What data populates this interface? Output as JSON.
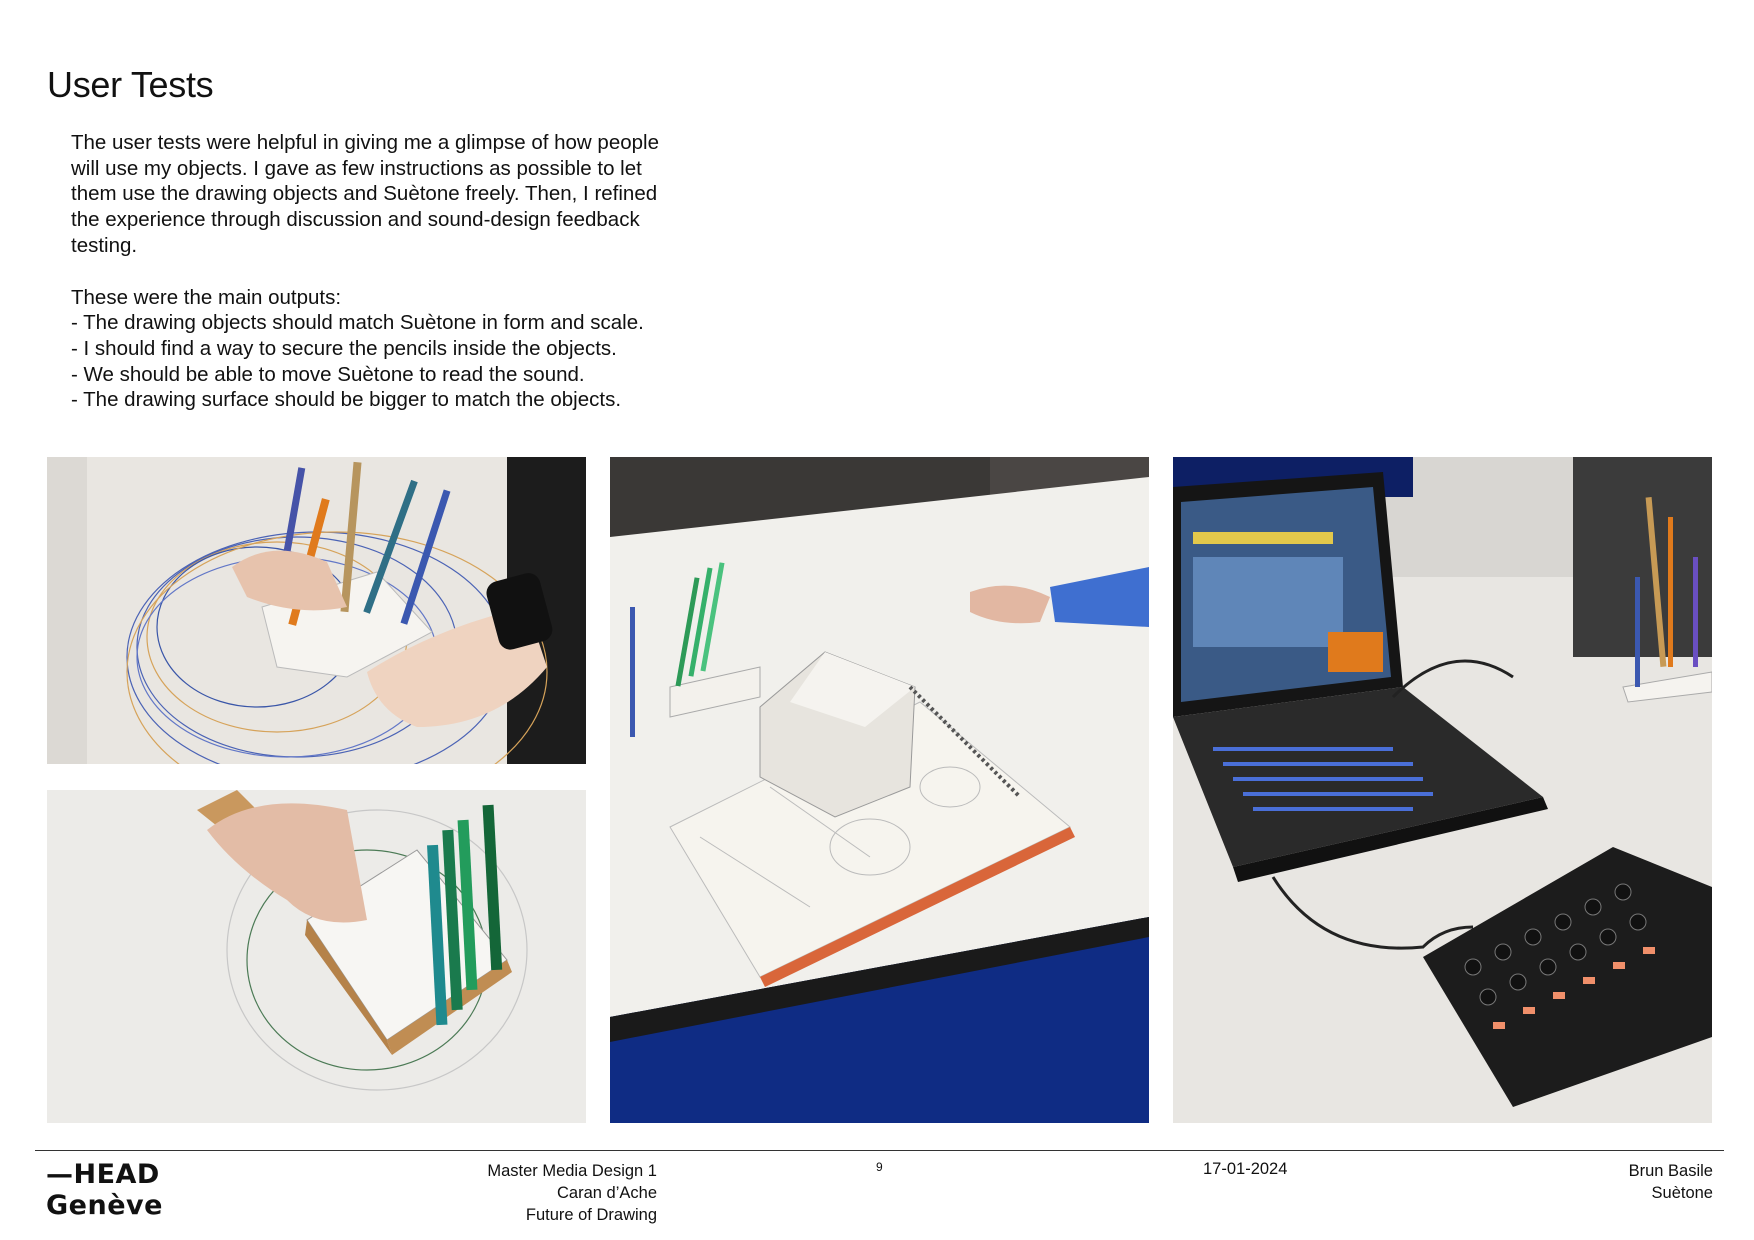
{
  "page": {
    "title": "User Tests",
    "intro": "The user tests were helpful in giving me a glimpse of how people will use my objects. I gave as few instructions as possible to let them use the drawing objects and Suètone freely. Then, I refined the experience through discussion and sound-design feedback testing.",
    "outputs_heading": "These were the main outputs:",
    "outputs": [
      "- The drawing objects should match Suètone in form and scale.",
      "- I should find a way to secure the pencils inside the objects.",
      "- We should be able to move Suètone to read the sound.",
      "- The drawing surface should be bigger to match the objects."
    ]
  },
  "photos": {
    "photo_1": "hand-pencil-holder-circles-icon",
    "photo_2": "hand-green-pencils-holder-icon",
    "photo_3": "paper-sculpture-sketchbook-icon",
    "photo_4": "laptop-midi-controller-icon"
  },
  "footer": {
    "logo_line1": "—HEAD",
    "logo_line2": "Genève",
    "course_lines": [
      "Master Media Design 1",
      "Caran d’Ache",
      "Future of Drawing"
    ],
    "page_number": "9",
    "date": "17-01-2024",
    "author": "Brun Basile",
    "project": "Suètone"
  }
}
